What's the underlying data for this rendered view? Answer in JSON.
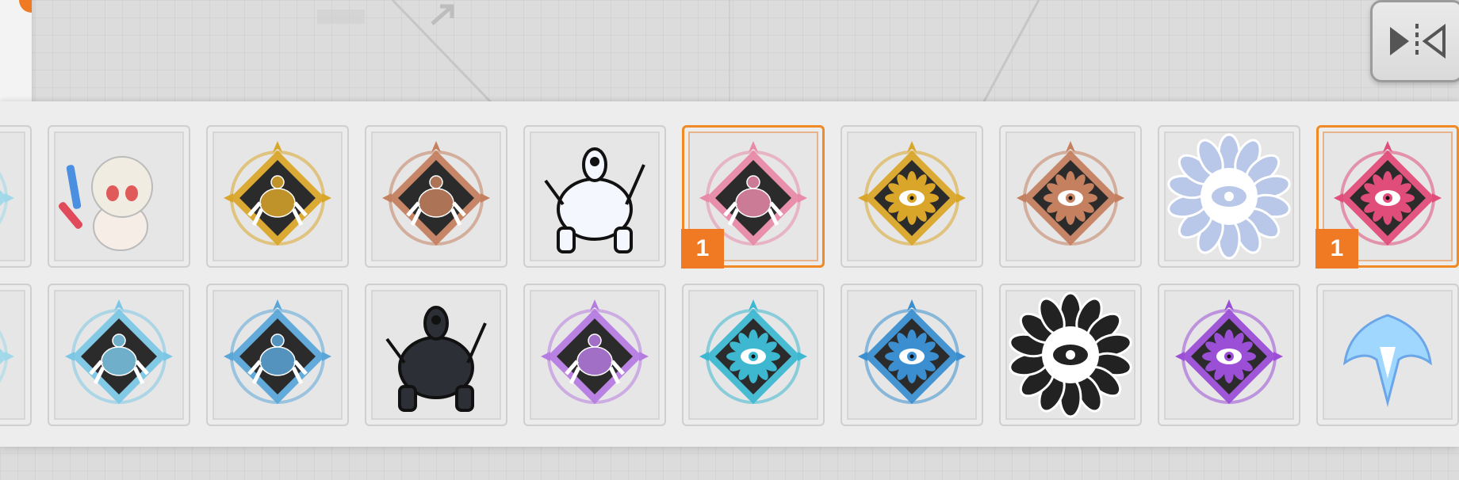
{
  "mirror_button": {
    "icon": "mirror-flip-icon"
  },
  "colors": {
    "accent": "#f07a24",
    "panel": "#ededed",
    "cell": "#e6e6e6"
  },
  "stickers": [
    {
      "icon": "partial-sticker-icon",
      "style": "crab",
      "hue": "#9fd8e8",
      "selected": false,
      "badge": ""
    },
    {
      "icon": "anime-girl-sticker-icon",
      "style": "girl",
      "hue": "#f4e3d7",
      "selected": false,
      "badge": ""
    },
    {
      "icon": "gold-crab-emblem-icon",
      "style": "crab",
      "hue": "#d9a62a",
      "selected": false,
      "badge": ""
    },
    {
      "icon": "bronze-crab-emblem-icon",
      "style": "crab",
      "hue": "#c4805f",
      "selected": false,
      "badge": ""
    },
    {
      "icon": "white-crab-monster-sticker-icon",
      "style": "monster",
      "hue": "#f5f7ff",
      "selected": false,
      "badge": ""
    },
    {
      "icon": "pink-crab-emblem-icon",
      "style": "crab",
      "hue": "#e88aa8",
      "selected": true,
      "badge": "1"
    },
    {
      "icon": "gold-eye-emblem-icon",
      "style": "eye",
      "hue": "#d9a62a",
      "selected": false,
      "badge": ""
    },
    {
      "icon": "bronze-eye-emblem-icon",
      "style": "eye",
      "hue": "#c4805f",
      "selected": false,
      "badge": ""
    },
    {
      "icon": "holo-eye-shell-sticker-icon",
      "style": "shell",
      "hue": "#b9c7e8",
      "selected": false,
      "badge": ""
    },
    {
      "icon": "pink-eye-emblem-icon",
      "style": "eye",
      "hue": "#e04d7a",
      "selected": true,
      "badge": "1"
    },
    {
      "icon": "partial-sticker-icon",
      "style": "crab",
      "hue": "#c9c9c9",
      "selected": false,
      "badge": ""
    },
    {
      "icon": "partial-sticker-icon",
      "style": "crab",
      "hue": "#c9c9c9",
      "selected": false,
      "badge": ""
    },
    {
      "icon": "partial-sticker-icon",
      "style": "crab",
      "hue": "#9fd8e8",
      "selected": false,
      "badge": ""
    },
    {
      "icon": "ice-crab-emblem-icon",
      "style": "crab",
      "hue": "#7cc7e6",
      "selected": false,
      "badge": ""
    },
    {
      "icon": "blue-crab-emblem-icon",
      "style": "crab",
      "hue": "#5aa6d8",
      "selected": false,
      "badge": ""
    },
    {
      "icon": "dark-crab-monster-sticker-icon",
      "style": "monster",
      "hue": "#2c2f35",
      "selected": false,
      "badge": ""
    },
    {
      "icon": "purple-crab-emblem-icon",
      "style": "crab",
      "hue": "#b67be0",
      "selected": false,
      "badge": ""
    },
    {
      "icon": "ice-eye-emblem-icon",
      "style": "eye",
      "hue": "#3db8d0",
      "selected": false,
      "badge": ""
    },
    {
      "icon": "blue-eye-emblem-icon",
      "style": "eye",
      "hue": "#3b8fd0",
      "selected": false,
      "badge": ""
    },
    {
      "icon": "black-eye-shell-sticker-icon",
      "style": "shell",
      "hue": "#222222",
      "selected": false,
      "badge": ""
    },
    {
      "icon": "purple-eye-emblem-icon",
      "style": "eye",
      "hue": "#9b4fd6",
      "selected": false,
      "badge": ""
    },
    {
      "icon": "phoenix-sticker-icon",
      "style": "phoenix",
      "hue": "#9fd7ff",
      "selected": false,
      "badge": ""
    },
    {
      "icon": "partial-sticker-icon",
      "style": "crab",
      "hue": "#c9c9c9",
      "selected": false,
      "badge": ""
    },
    {
      "icon": "partial-sticker-icon",
      "style": "crab",
      "hue": "#c9c9c9",
      "selected": false,
      "badge": ""
    }
  ]
}
